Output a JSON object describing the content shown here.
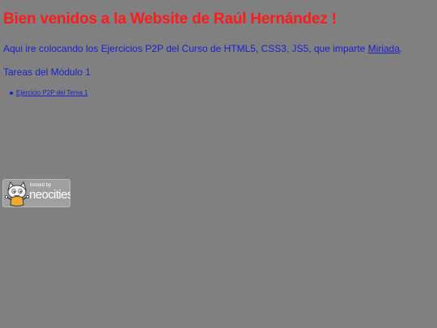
{
  "page": {
    "title": "Bien venidos a la Website de Raúl Hernández !",
    "intro_text": "Aqui ire colocando los Ejercicios P2P del Curso de HTML5, CSS3, JS5, que imparte ",
    "intro_link": "Miriada",
    "intro_end": ".",
    "section_heading": "Tareas del Módulo 1"
  },
  "tasks": [
    {
      "label": "Ejercicio P2P del Tema 1"
    }
  ],
  "badge": {
    "hosted_by": "hosted by",
    "brand": "neocities",
    "icon": "neocities-cat-icon"
  },
  "colors": {
    "background": "#808080",
    "title": "#ff1a1a",
    "text": "#1a22cc"
  }
}
